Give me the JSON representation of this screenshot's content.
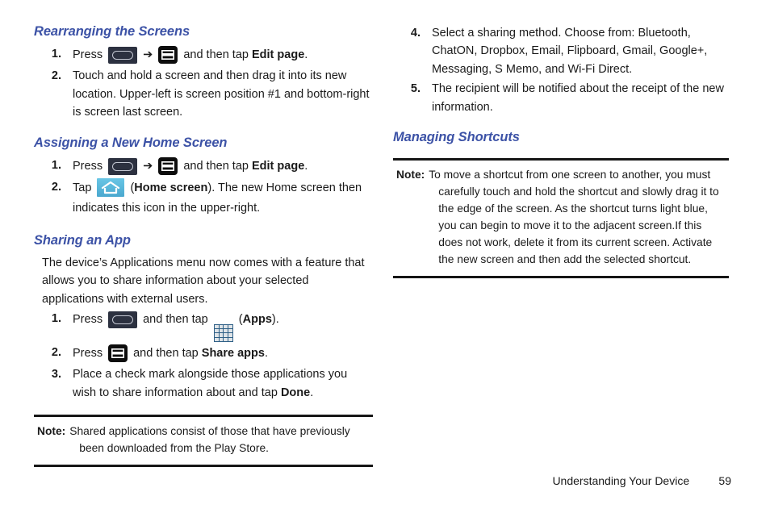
{
  "document": {
    "footer": {
      "chapter": "Understanding Your Device",
      "page_number": "59"
    },
    "heading_color": "#3c52a6"
  },
  "left_column": {
    "sections": [
      {
        "heading": "Rearranging the Screens",
        "steps": [
          {
            "num": "1.",
            "parts": [
              {
                "type": "text",
                "text": "Press "
              },
              {
                "type": "icon",
                "icon": "menu-key-icon"
              },
              {
                "type": "text",
                "text": " ➔ "
              },
              {
                "type": "icon",
                "icon": "menu-page-icon"
              },
              {
                "type": "text",
                "text": " and then tap "
              },
              {
                "type": "bold",
                "text": "Edit page"
              },
              {
                "type": "text",
                "text": "."
              }
            ]
          },
          {
            "num": "2.",
            "parts": [
              {
                "type": "text",
                "text": "Touch and hold a screen and then drag it into its new location. Upper-left is screen position #1 and bottom-right is screen last screen."
              }
            ]
          }
        ]
      },
      {
        "heading": "Assigning a New Home Screen",
        "steps": [
          {
            "num": "1.",
            "parts": [
              {
                "type": "text",
                "text": "Press "
              },
              {
                "type": "icon",
                "icon": "menu-key-icon"
              },
              {
                "type": "text",
                "text": " ➔ "
              },
              {
                "type": "icon",
                "icon": "menu-page-icon"
              },
              {
                "type": "text",
                "text": " and then tap "
              },
              {
                "type": "bold",
                "text": "Edit page"
              },
              {
                "type": "text",
                "text": "."
              }
            ]
          },
          {
            "num": "2.",
            "parts": [
              {
                "type": "text",
                "text": "Tap "
              },
              {
                "type": "icon",
                "icon": "home-screen-icon"
              },
              {
                "type": "text",
                "text": " ("
              },
              {
                "type": "bold",
                "text": "Home screen"
              },
              {
                "type": "text",
                "text": "). The new Home screen then indicates this icon in the upper-right."
              }
            ]
          }
        ]
      },
      {
        "heading": "Sharing an App",
        "paragraph": "The device’s Applications menu now comes with a feature that allows you to share information about your selected applications with external users.",
        "steps": [
          {
            "num": "1.",
            "parts": [
              {
                "type": "text",
                "text": "Press "
              },
              {
                "type": "icon",
                "icon": "menu-key-icon"
              },
              {
                "type": "text",
                "text": " and then tap "
              },
              {
                "type": "icon",
                "icon": "apps-grid-icon"
              },
              {
                "type": "text",
                "text": " ("
              },
              {
                "type": "bold",
                "text": "Apps"
              },
              {
                "type": "text",
                "text": ")."
              }
            ]
          },
          {
            "num": "2.",
            "parts": [
              {
                "type": "text",
                "text": "Press "
              },
              {
                "type": "icon",
                "icon": "menu-page-icon"
              },
              {
                "type": "text",
                "text": " and then tap "
              },
              {
                "type": "bold",
                "text": "Share apps"
              },
              {
                "type": "text",
                "text": "."
              }
            ]
          },
          {
            "num": "3.",
            "parts": [
              {
                "type": "text",
                "text": "Place a check mark alongside those applications you wish to share information about and tap "
              },
              {
                "type": "bold",
                "text": "Done"
              },
              {
                "type": "text",
                "text": "."
              }
            ]
          }
        ]
      }
    ],
    "note": {
      "label": "Note:",
      "text": "Shared applications consist of those that have previously been downloaded from the Play Store."
    }
  },
  "right_column": {
    "steps": [
      {
        "num": "4.",
        "parts": [
          {
            "type": "text",
            "text": "Select a sharing method. Choose from: Bluetooth, ChatON, Dropbox, Email, Flipboard, Gmail, Google+, Messaging, S Memo, and Wi-Fi Direct."
          }
        ]
      },
      {
        "num": "5.",
        "parts": [
          {
            "type": "text",
            "text": "The recipient will be notified about the receipt of the new information."
          }
        ]
      }
    ],
    "sections": [
      {
        "heading": "Managing Shortcuts"
      }
    ],
    "note": {
      "label": "Note:",
      "text": "To move a shortcut from one screen to another, you must carefully touch and hold the shortcut and slowly drag it to the edge of the screen. As the shortcut turns light blue, you can begin to move it to the adjacent screen.If this does not work, delete it from its current screen. Activate the new screen and then add the selected shortcut."
    }
  }
}
